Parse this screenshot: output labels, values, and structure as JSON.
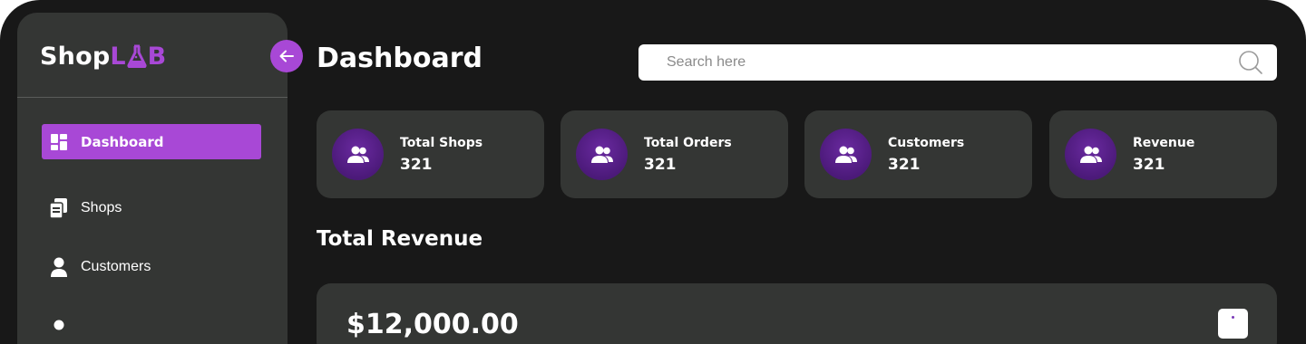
{
  "app": {
    "logo_part1": "Shop",
    "logo_part2": "LAB"
  },
  "sidebar": {
    "items": [
      {
        "label": "Dashboard",
        "icon": "dashboard-grid-icon",
        "active": true
      },
      {
        "label": "Shops",
        "icon": "shops-docs-icon",
        "active": false
      },
      {
        "label": "Customers",
        "icon": "user-icon",
        "active": false
      }
    ]
  },
  "header": {
    "title": "Dashboard",
    "search_placeholder": "Search here"
  },
  "stats": [
    {
      "label": "Total Shops",
      "value": "321",
      "icon": "users-icon"
    },
    {
      "label": "Total Orders",
      "value": "321",
      "icon": "users-icon"
    },
    {
      "label": "Customers",
      "value": "321",
      "icon": "users-icon"
    },
    {
      "label": "Revenue",
      "value": "321",
      "icon": "users-icon"
    }
  ],
  "revenue": {
    "title": "Total Revenue",
    "amount": "$12,000.00"
  },
  "colors": {
    "accent": "#a848d6",
    "background": "#181818",
    "panel": "#343634",
    "avatar": "#4c1a7a"
  }
}
